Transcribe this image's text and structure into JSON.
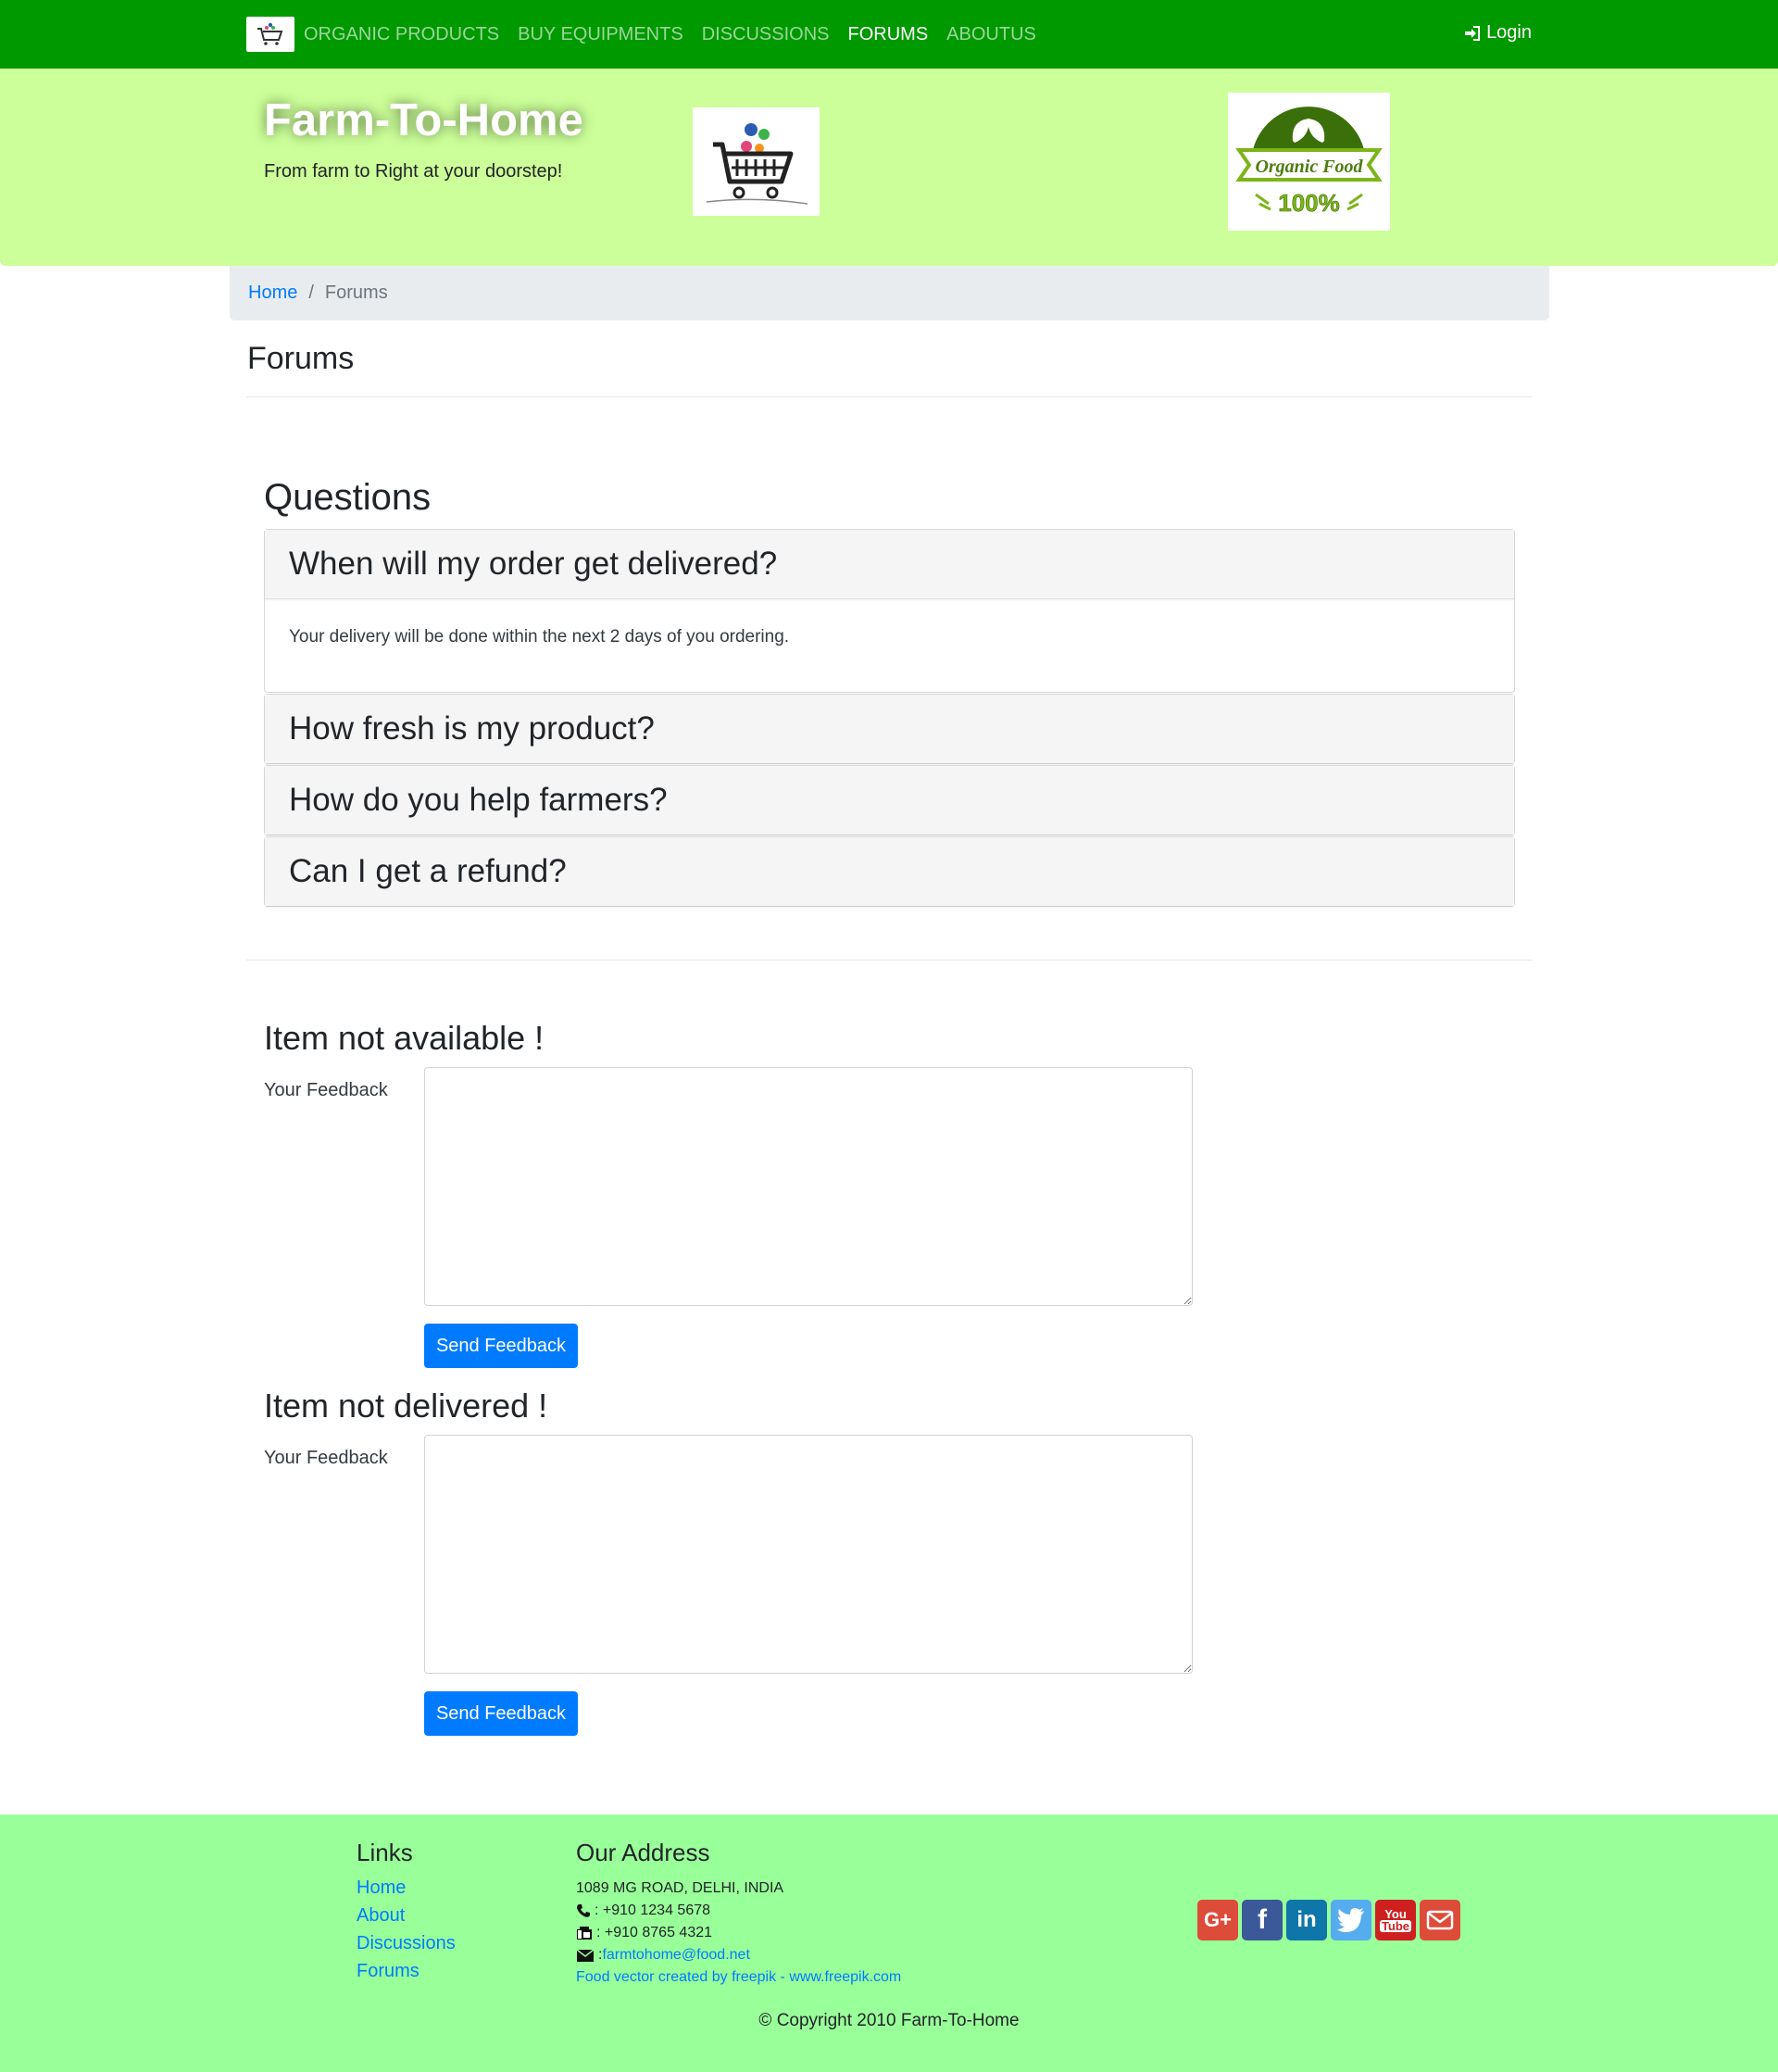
{
  "nav": {
    "items": [
      {
        "label": "ORGANIC PRODUCTS",
        "active": false
      },
      {
        "label": "BUY EQUIPMENTS",
        "active": false
      },
      {
        "label": "DISCUSSIONS",
        "active": false
      },
      {
        "label": "FORUMS",
        "active": true
      },
      {
        "label": "ABOUTUS",
        "active": false
      }
    ],
    "login_label": "Login"
  },
  "header": {
    "title": "Farm-To-Home",
    "tagline": "From farm to Right at your doorstep!",
    "logo_text_line1": "Organic Food",
    "logo_text_line2": "100%"
  },
  "breadcrumb": {
    "home": "Home",
    "current": "Forums"
  },
  "page": {
    "title": "Forums"
  },
  "questions": {
    "title": "Questions",
    "items": [
      {
        "question": "When will my order get delivered?",
        "answer": "Your delivery will be done within the next 2 days of you ordering.",
        "expanded": true
      },
      {
        "question": "How fresh is my product?",
        "expanded": false
      },
      {
        "question": "How do you help farmers?",
        "expanded": false
      },
      {
        "question": "Can I get a refund?",
        "expanded": false
      }
    ]
  },
  "feedback_forms": [
    {
      "title": "Item not available !",
      "label": "Your Feedback",
      "value": "",
      "button": "Send Feedback"
    },
    {
      "title": "Item not delivered !",
      "label": "Your Feedback",
      "value": "",
      "button": "Send Feedback"
    }
  ],
  "footer": {
    "links_title": "Links",
    "links": [
      "Home",
      "About",
      "Discussions",
      "Forums"
    ],
    "address_title": "Our Address",
    "address": "1089 MG ROAD, DELHI, INDIA",
    "phone": ": +910 1234 5678",
    "fax": ": +910 8765 4321",
    "email_prefix": ": ",
    "email": "farmtohome@food.net",
    "credit": "Food vector created by freepik - www.freepik.com",
    "social": [
      "google-plus",
      "facebook",
      "linkedin",
      "twitter",
      "youtube",
      "mail"
    ],
    "copyright": "© Copyright 2010 Farm-To-Home"
  },
  "colors": {
    "navbar": "#009900",
    "jumbotron": "#ccff99",
    "footer": "#99ff99",
    "primary": "#007bff"
  }
}
